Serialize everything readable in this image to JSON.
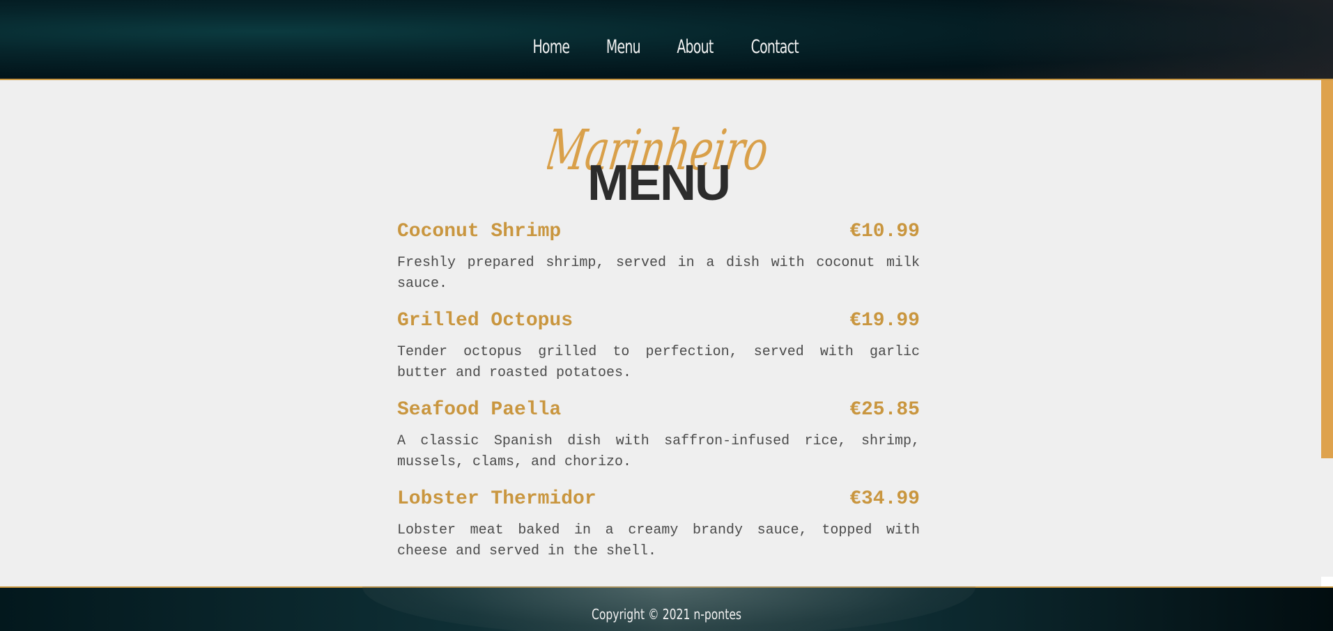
{
  "nav": {
    "items": [
      {
        "label": "Home"
      },
      {
        "label": "Menu"
      },
      {
        "label": "About"
      },
      {
        "label": "Contact"
      }
    ]
  },
  "brand": {
    "logo_text": "Marinheiro",
    "accent": "#c9963f"
  },
  "page": {
    "heading": "MENU"
  },
  "menu_items": [
    {
      "name": "Coconut Shrimp",
      "price": "€10.99",
      "description": "Freshly prepared shrimp, served in a dish with coconut milk sauce."
    },
    {
      "name": "Grilled Octopus",
      "price": "€19.99",
      "description": "Tender octopus grilled to perfection, served with garlic butter and roasted potatoes."
    },
    {
      "name": "Seafood Paella",
      "price": "€25.85",
      "description": "A classic Spanish dish with saffron-infused rice, shrimp, mussels, clams, and chorizo."
    },
    {
      "name": "Lobster Thermidor",
      "price": "€34.99",
      "description": "Lobster meat baked in a creamy brandy sauce, topped with cheese and served in the shell."
    }
  ],
  "footer": {
    "copyright": "Copyright © 2021 n-pontes"
  }
}
